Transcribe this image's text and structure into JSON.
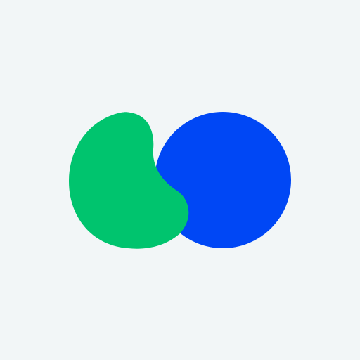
{
  "colors": {
    "background": "#F2F6F7",
    "green": "#00C46E",
    "blue": "#0047F5"
  },
  "logo": {
    "icon": "two-overlapping-shapes-logo-icon"
  }
}
